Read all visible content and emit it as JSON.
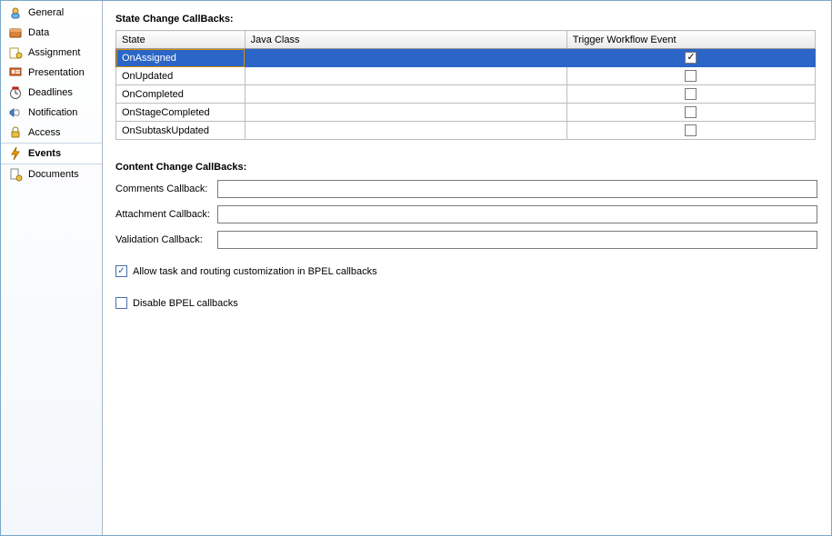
{
  "sidebar": {
    "items": [
      {
        "label": "General"
      },
      {
        "label": "Data"
      },
      {
        "label": "Assignment"
      },
      {
        "label": "Presentation"
      },
      {
        "label": "Deadlines"
      },
      {
        "label": "Notification"
      },
      {
        "label": "Access"
      },
      {
        "label": "Events"
      },
      {
        "label": "Documents"
      }
    ]
  },
  "section1_title": "State Change CallBacks:",
  "table": {
    "headers": {
      "state": "State",
      "java": "Java Class",
      "trigger": "Trigger Workflow Event"
    },
    "rows": [
      {
        "state": "OnAssigned",
        "java": "",
        "trigger": true,
        "selected": true
      },
      {
        "state": "OnUpdated",
        "java": "",
        "trigger": false,
        "selected": false
      },
      {
        "state": "OnCompleted",
        "java": "",
        "trigger": false,
        "selected": false
      },
      {
        "state": "OnStageCompleted",
        "java": "",
        "trigger": false,
        "selected": false
      },
      {
        "state": "OnSubtaskUpdated",
        "java": "",
        "trigger": false,
        "selected": false
      }
    ]
  },
  "section2_title": "Content Change CallBacks:",
  "fields": {
    "comments_label": "Comments Callback:",
    "comments_value": "",
    "attachment_label": "Attachment Callback:",
    "attachment_value": "",
    "validation_label": "Validation Callback:",
    "validation_value": ""
  },
  "checks": {
    "allow_label": "Allow task and routing customization in BPEL callbacks",
    "allow_checked": true,
    "disable_label": "Disable BPEL callbacks",
    "disable_checked": false
  }
}
